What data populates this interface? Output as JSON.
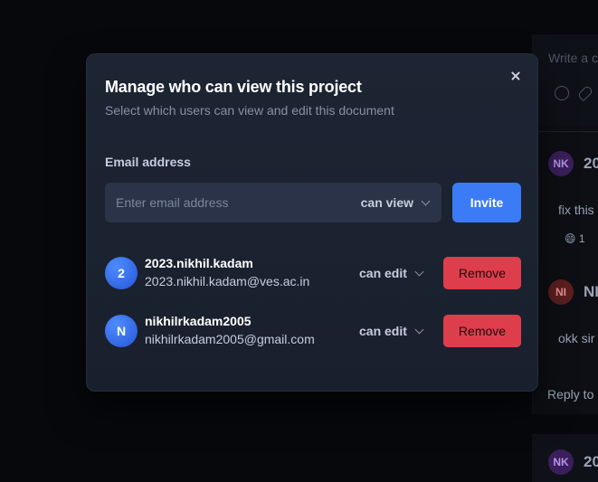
{
  "modal": {
    "title": "Manage who can view this project",
    "subtitle": "Select which users can view and edit this document",
    "email_label": "Email address",
    "email_placeholder": "Enter email address",
    "email_value": "",
    "permission_selected": "can view",
    "invite_label": "Invite",
    "users": [
      {
        "initial": "2",
        "name": "2023.nikhil.kadam",
        "email": "2023.nikhil.kadam@ves.ac.in",
        "permission": "can edit",
        "remove_label": "Remove"
      },
      {
        "initial": "N",
        "name": "nikhilrkadam2005",
        "email": "nikhilrkadam2005@gmail.com",
        "permission": "can edit",
        "remove_label": "Remove"
      }
    ]
  },
  "background": {
    "compose_placeholder": "Write a c",
    "comments": [
      {
        "avatar": "NK",
        "author": "20",
        "text": "fix this",
        "reaction": "😄 1"
      },
      {
        "avatar": "NI",
        "author": "NI",
        "text": "okk sir",
        "reply": "Reply to"
      },
      {
        "avatar": "NK",
        "author": "20"
      }
    ]
  },
  "colors": {
    "accent": "#3b7cf6",
    "danger": "#de3e4c",
    "modal_bg": "#1d2433",
    "input_bg": "#2a3347"
  }
}
